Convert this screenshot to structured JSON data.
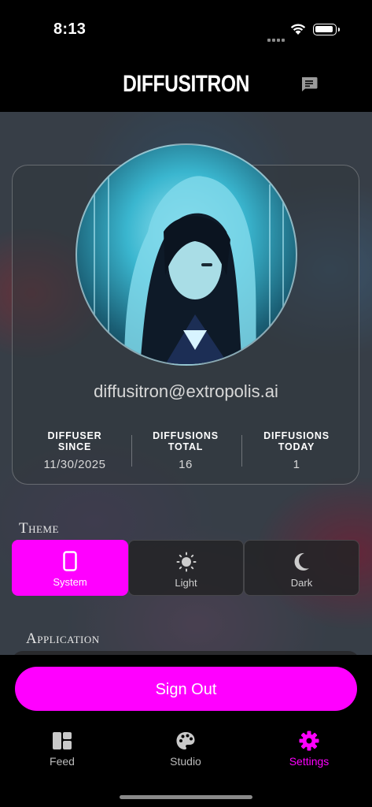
{
  "status_bar": {
    "time": "8:13"
  },
  "header": {
    "title": "DIFFUSITRON",
    "chat_icon": "chat-bubble-icon"
  },
  "profile": {
    "email": "diffusitron@extropolis.ai",
    "stats": [
      {
        "label_line1": "DIFFUSER",
        "label_line2": "SINCE",
        "value": "11/30/2025"
      },
      {
        "label_line1": "DIFFUSIONS",
        "label_line2": "TOTAL",
        "value": "16"
      },
      {
        "label_line1": "DIFFUSIONS",
        "label_line2": "TODAY",
        "value": "1"
      }
    ]
  },
  "theme": {
    "title": "Theme",
    "options": [
      {
        "label": "System",
        "icon": "phone-icon",
        "selected": true
      },
      {
        "label": "Light",
        "icon": "sun-icon",
        "selected": false
      },
      {
        "label": "Dark",
        "icon": "moon-icon",
        "selected": false
      }
    ]
  },
  "application": {
    "title": "Application"
  },
  "sign_out_label": "Sign Out",
  "tabs": [
    {
      "label": "Feed",
      "icon": "feed-grid-icon",
      "active": false
    },
    {
      "label": "Studio",
      "icon": "palette-icon",
      "active": false
    },
    {
      "label": "Settings",
      "icon": "gear-icon",
      "active": true
    }
  ],
  "colors": {
    "accent": "#ff00ff",
    "background": "#000000"
  }
}
